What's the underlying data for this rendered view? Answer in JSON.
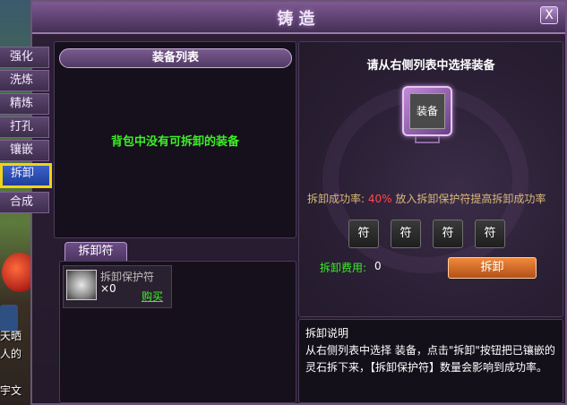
{
  "window": {
    "title": "铸造",
    "close_label": "X"
  },
  "background": {
    "lines": [
      "天晒",
      "人的",
      "宇文"
    ]
  },
  "tabs": [
    {
      "label": "强化"
    },
    {
      "label": "洗炼"
    },
    {
      "label": "精炼"
    },
    {
      "label": "打孔"
    },
    {
      "label": "镶嵌"
    },
    {
      "label": "拆卸",
      "active": true
    },
    {
      "label": "合成"
    }
  ],
  "equipment_list": {
    "header": "装备列表",
    "empty_message": "背包中没有可拆卸的装备"
  },
  "charm": {
    "tab_label": "拆卸符",
    "item_name": "拆卸保护符",
    "item_count": "×0",
    "buy_label": "购买"
  },
  "right": {
    "instruction": "请从右侧列表中选择装备",
    "slot_label": "装备",
    "rate_label": "拆卸成功率:",
    "rate_value": "40%",
    "rate_hint": "放入拆卸保护符提高拆卸成功率",
    "charm_slots": [
      "符",
      "符",
      "符",
      "符"
    ],
    "cost_label": "拆卸费用:",
    "cost_value": "0",
    "button_label": "拆卸"
  },
  "description": {
    "title": "拆卸说明",
    "text": "从右侧列表中选择 装备，点击\"拆卸\"按钮把已镶嵌的灵石拆下来，【拆卸保护符】数量会影响到成功率。"
  },
  "colors": {
    "accent_green": "#3cf026",
    "rate_red": "#ff4a4a",
    "active_tab_border": "#f2d21a"
  }
}
